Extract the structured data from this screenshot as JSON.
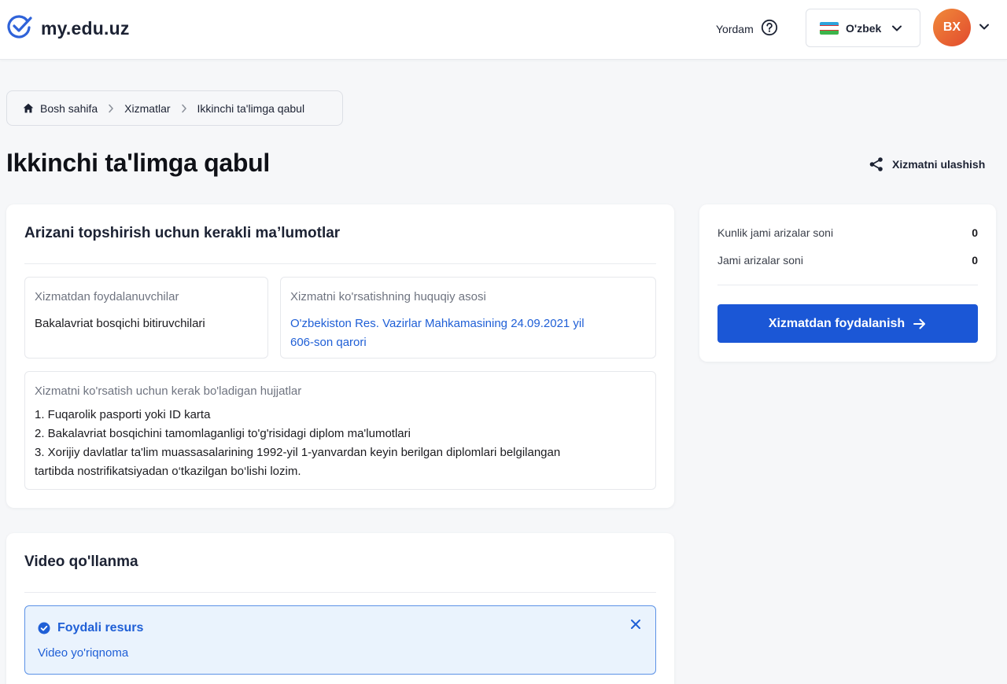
{
  "header": {
    "logo_text": "my.edu.uz",
    "help_label": "Yordam",
    "language_label": "O'zbek",
    "avatar_initials": "BX"
  },
  "breadcrumb": {
    "items": [
      "Bosh sahifa",
      "Xizmatlar",
      "Ikkinchi ta'limga qabul"
    ]
  },
  "page": {
    "title": "Ikkinchi ta'limga qabul",
    "share_label": "Xizmatni ulashish"
  },
  "info_card": {
    "title": "Arizani topshirish uchun kerakli ma’lumotlar",
    "beneficiaries_label": "Xizmatdan foydalanuvchilar",
    "beneficiaries_value": "Bakalavriat bosqichi bitiruvchilari",
    "legal_basis_label": "Xizmatni ko'rsatishning huquqiy asosi",
    "legal_basis_line1": "O'zbekiston Res. Vazirlar Mahkamasining 24.09.2021 yil",
    "legal_basis_line2": "606-son qarori",
    "documents_label": "Xizmatni ko'rsatish uchun kerak bo'ladigan hujjatlar",
    "documents": [
      "1. Fuqarolik pasporti yoki ID karta",
      "2. Bakalavriat bosqichini tamomlaganligi to'g'risidagi diplom ma'lumotlari",
      "3. Xorijiy davlatlar ta'lim muassasalarining 1992-yil 1-yanvardan keyin berilgan diplomlari belgilangan",
      "tartibda nostrifikatsiyadan o‘tkazilgan bo‘lishi lozim."
    ]
  },
  "stats_card": {
    "daily_label": "Kunlik jami arizalar soni",
    "daily_value": "0",
    "total_label": "Jami arizalar soni",
    "total_value": "0",
    "button_label": "Xizmatdan foydalanish"
  },
  "video_card": {
    "title": "Video qo'llanma",
    "alert_title": "Foydali resurs",
    "alert_link": "Video yo'riqnoma"
  },
  "colors": {
    "primary": "#1b57d6",
    "link": "#1f5fd6",
    "avatar_gradient_start": "#f08a3a",
    "avatar_gradient_end": "#e24a2e",
    "alert_bg": "#eaf3fd"
  },
  "icons": {
    "logo": "check-circle-icon",
    "help": "question-circle-icon",
    "language": "uzbekistan-flag-icon",
    "chevron": "chevron-down-icon",
    "home": "home-icon",
    "breadcrumb_separator": "chevron-right-icon",
    "share": "share-icon",
    "button_arrow": "arrow-right-icon",
    "alert": "check-circle-filled-icon",
    "close": "close-icon"
  }
}
